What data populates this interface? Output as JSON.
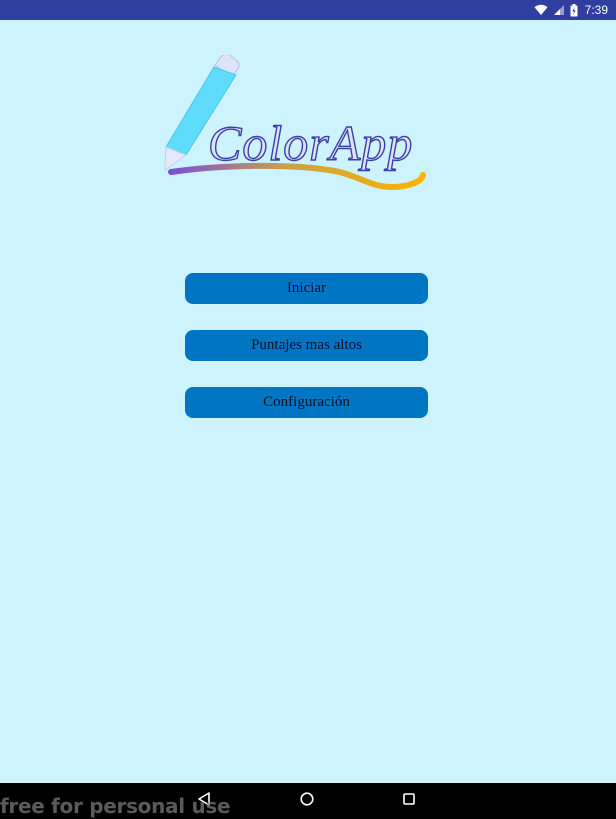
{
  "status_bar": {
    "time": "7:39",
    "icons": [
      "wifi-icon",
      "cellular-signal-icon",
      "battery-icon"
    ]
  },
  "logo": {
    "text": "ColorApp",
    "icon": "pencil-icon"
  },
  "menu": {
    "start_label": "Iniciar",
    "high_scores_label": "Puntajes mas altos",
    "settings_label": "Configuración"
  },
  "nav_bar": {
    "icons": [
      "back-icon",
      "home-icon",
      "recents-icon"
    ]
  },
  "watermark": {
    "text": "free for personal use"
  },
  "colors": {
    "status_bar": "#303f9f",
    "background": "#cdf3fe",
    "button": "#0075c1",
    "button_text": "#0b1230",
    "pencil": "#5fdbfb",
    "swoosh_start": "#7b4fd6",
    "swoosh_end": "#ffb300"
  }
}
